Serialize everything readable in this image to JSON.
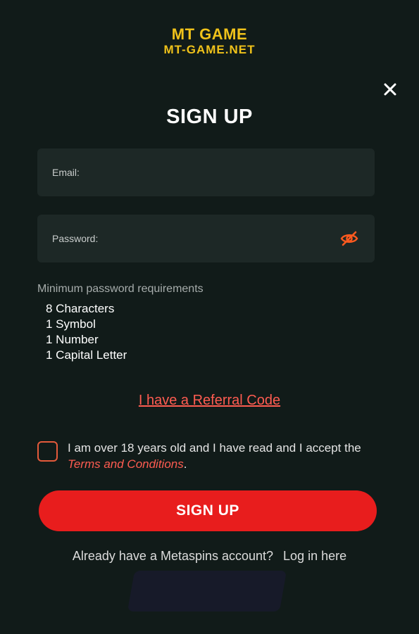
{
  "logo": {
    "line1": "MT GAME",
    "line2": "MT-GAME.NET"
  },
  "header": {
    "title": "SIGN UP",
    "close_icon": "close-icon"
  },
  "form": {
    "email": {
      "label": "Email:",
      "value": ""
    },
    "password": {
      "label": "Password:",
      "value": "",
      "toggle_icon": "eye-slash-icon"
    }
  },
  "requirements": {
    "title": "Minimum password requirements",
    "items": [
      "8 Characters",
      "1 Symbol",
      "1 Number",
      "1 Capital Letter"
    ]
  },
  "referral": {
    "label": "I have a Referral Code"
  },
  "terms": {
    "checked": false,
    "text_before": "I am over 18 years old and I have read and I accept the ",
    "link": "Terms and Conditions",
    "text_after": "."
  },
  "signup_button": {
    "label": "SIGN UP"
  },
  "login": {
    "prompt": "Already have a Metaspins account?",
    "link": "Log in here"
  },
  "colors": {
    "background": "#111b19",
    "field": "#1d2826",
    "accent": "#e81d1d",
    "link": "#ff5c51",
    "logo": "#f0c21a"
  }
}
